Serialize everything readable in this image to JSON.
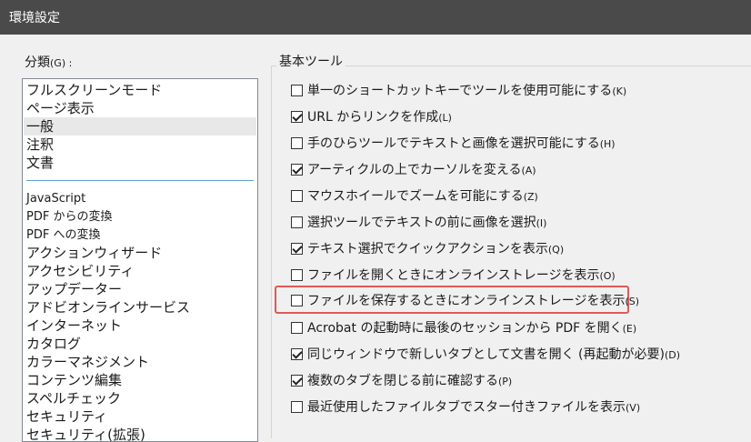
{
  "window": {
    "title": "環境設定"
  },
  "categories": {
    "label": "分類",
    "label_accel": "(G) :",
    "top_items": [
      {
        "label": "フルスクリーンモード"
      },
      {
        "label": "ページ表示"
      },
      {
        "label": "一般",
        "selected": true
      },
      {
        "label": "注釈"
      },
      {
        "label": "文書"
      }
    ],
    "items": [
      {
        "label": "JavaScript"
      },
      {
        "label": "PDF からの変換"
      },
      {
        "label": "PDF への変換"
      },
      {
        "label": "アクションウィザード"
      },
      {
        "label": "アクセシビリティ"
      },
      {
        "label": "アップデーター"
      },
      {
        "label": "アドビオンラインサービス"
      },
      {
        "label": "インターネット"
      },
      {
        "label": "カタログ"
      },
      {
        "label": "カラーマネジメント"
      },
      {
        "label": "コンテンツ編集"
      },
      {
        "label": "スペルチェック"
      },
      {
        "label": "セキュリティ"
      },
      {
        "label": "セキュリティ(拡張)"
      }
    ]
  },
  "basic_tools": {
    "title": "基本ツール",
    "options": [
      {
        "text": "単一のショートカットキーでツールを使用可能にする",
        "accel": "(K)",
        "checked": false
      },
      {
        "text": "URL からリンクを作成",
        "accel": "(L)",
        "checked": true
      },
      {
        "text": "手のひらツールでテキストと画像を選択可能にする",
        "accel": "(H)",
        "checked": false
      },
      {
        "text": "アーティクルの上でカーソルを変える",
        "accel": "(A)",
        "checked": true
      },
      {
        "text": "マウスホイールでズームを可能にする",
        "accel": "(Z)",
        "checked": false
      },
      {
        "text": "選択ツールでテキストの前に画像を選択",
        "accel": "(I)",
        "checked": false
      },
      {
        "text": "テキスト選択でクイックアクションを表示",
        "accel": "(Q)",
        "checked": true
      },
      {
        "text": "ファイルを開くときにオンラインストレージを表示",
        "accel": "(O)",
        "checked": false
      },
      {
        "text": "ファイルを保存するときにオンラインストレージを表示",
        "accel": "(S)",
        "checked": false,
        "highlighted": true
      },
      {
        "text": "Acrobat の起動時に最後のセッションから PDF を開く",
        "accel": "(E)",
        "checked": false
      },
      {
        "text": "同じウィンドウで新しいタブとして文書を開く (再起動が必要)",
        "accel": "(D)",
        "checked": true
      },
      {
        "text": "複数のタブを閉じる前に確認する",
        "accel": "(P)",
        "checked": true
      },
      {
        "text": "最近使用したファイルタブでスター付きファイルを表示",
        "accel": "(V)",
        "checked": false
      }
    ]
  },
  "colors": {
    "highlight": "#e05a5a",
    "titlebar": "#4a4a4a",
    "separator": "#5aa3c8"
  }
}
